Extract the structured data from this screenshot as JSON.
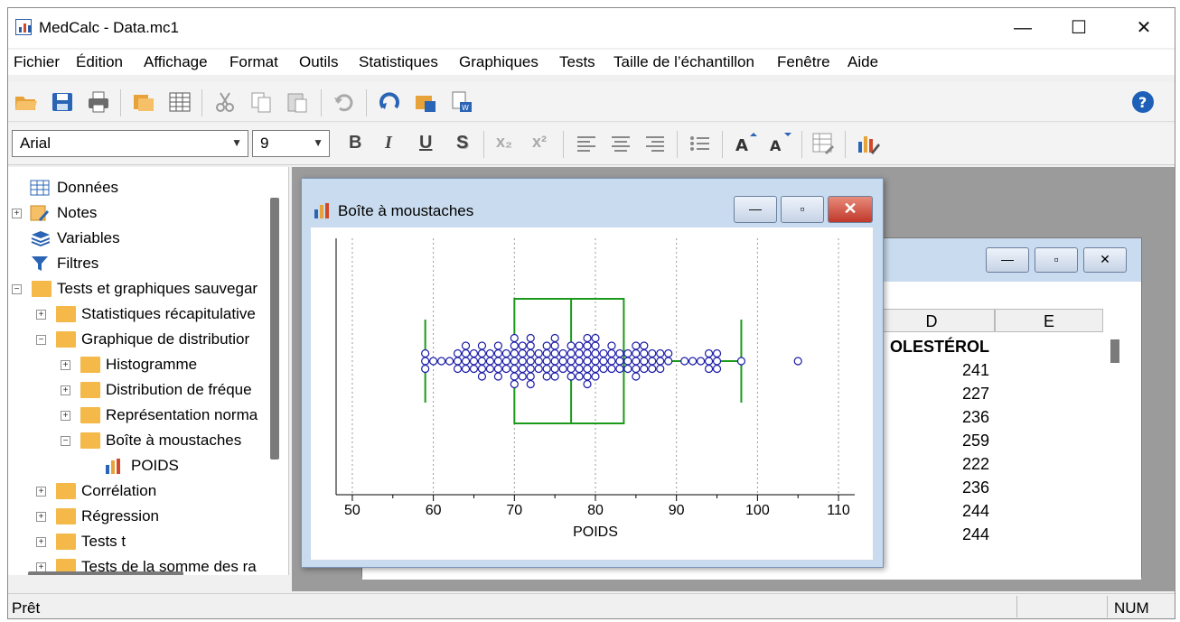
{
  "titlebar": {
    "title": "MedCalc - Data.mc1",
    "min": "—",
    "max": "☐",
    "close": "✕"
  },
  "menu": [
    "Fichier",
    "Édition",
    "Affichage",
    "Format",
    "Outils",
    "Statistiques",
    "Graphiques",
    "Tests",
    "Taille de l’échantillon",
    "Fenêtre",
    "Aide"
  ],
  "format": {
    "font": "Arial",
    "size": "9",
    "bold": "B",
    "italic": "I",
    "underline": "U",
    "shadow": "S",
    "sub": "x₂",
    "sup": "x²"
  },
  "tree": [
    {
      "label": "Données",
      "icon": "table-icon"
    },
    {
      "label": "Notes",
      "icon": "notes-icon"
    },
    {
      "label": "Variables",
      "icon": "variables-icon"
    },
    {
      "label": "Filtres",
      "icon": "filter-icon"
    },
    {
      "label": "Tests et graphiques sauvegar",
      "icon": "folder-icon"
    },
    {
      "label": "Statistiques récapitulative",
      "icon": "folder-icon"
    },
    {
      "label": "Graphique de distributior",
      "icon": "folder-icon"
    },
    {
      "label": "Histogramme",
      "icon": "folder-icon"
    },
    {
      "label": "Distribution de fréque",
      "icon": "folder-icon"
    },
    {
      "label": "Représentation norma",
      "icon": "folder-icon"
    },
    {
      "label": "Boîte à moustaches",
      "icon": "folder-icon"
    },
    {
      "label": "POIDS",
      "icon": "chart-icon"
    },
    {
      "label": "Corrélation",
      "icon": "folder-icon"
    },
    {
      "label": "Régression",
      "icon": "folder-icon"
    },
    {
      "label": "Tests t",
      "icon": "folder-icon"
    },
    {
      "label": "Tests de la somme des ra",
      "icon": "folder-icon"
    }
  ],
  "sheet": {
    "columns": [
      "D",
      "E"
    ],
    "header_cell": "OLESTÉROL",
    "values": [
      "241",
      "227",
      "236",
      "259",
      "222",
      "236",
      "244",
      "244"
    ]
  },
  "boxplot_window": {
    "title": "Boîte à moustaches"
  },
  "chart_data": {
    "type": "box",
    "xlabel": "POIDS",
    "xlim": [
      48,
      112
    ],
    "ticks": [
      "50",
      "60",
      "70",
      "80",
      "90",
      "100",
      "110"
    ],
    "whisker_low": 59,
    "q1": 70,
    "median": 77,
    "q3": 83.5,
    "whisker_high": 98,
    "outliers": [
      105
    ],
    "points": [
      [
        59,
        0
      ],
      [
        59,
        1
      ],
      [
        59,
        -1
      ],
      [
        60,
        0
      ],
      [
        61,
        0
      ],
      [
        62,
        0
      ],
      [
        63,
        0
      ],
      [
        63,
        1
      ],
      [
        63,
        -1
      ],
      [
        64,
        0
      ],
      [
        64,
        1
      ],
      [
        64,
        -1
      ],
      [
        64,
        2
      ],
      [
        65,
        0
      ],
      [
        65,
        1
      ],
      [
        65,
        -1
      ],
      [
        66,
        0
      ],
      [
        66,
        1
      ],
      [
        66,
        -1
      ],
      [
        66,
        2
      ],
      [
        66,
        -2
      ],
      [
        67,
        0
      ],
      [
        67,
        1
      ],
      [
        67,
        -1
      ],
      [
        68,
        0
      ],
      [
        68,
        1
      ],
      [
        68,
        -1
      ],
      [
        68,
        2
      ],
      [
        68,
        -2
      ],
      [
        69,
        0
      ],
      [
        69,
        1
      ],
      [
        69,
        -1
      ],
      [
        70,
        0
      ],
      [
        70,
        1
      ],
      [
        70,
        -1
      ],
      [
        70,
        2
      ],
      [
        70,
        -2
      ],
      [
        70,
        3
      ],
      [
        70,
        -3
      ],
      [
        71,
        0
      ],
      [
        71,
        1
      ],
      [
        71,
        -1
      ],
      [
        71,
        2
      ],
      [
        71,
        -2
      ],
      [
        72,
        0
      ],
      [
        72,
        1
      ],
      [
        72,
        -1
      ],
      [
        72,
        2
      ],
      [
        72,
        -2
      ],
      [
        72,
        3
      ],
      [
        72,
        -3
      ],
      [
        73,
        0
      ],
      [
        73,
        1
      ],
      [
        73,
        -1
      ],
      [
        74,
        0
      ],
      [
        74,
        1
      ],
      [
        74,
        -1
      ],
      [
        74,
        2
      ],
      [
        74,
        -2
      ],
      [
        75,
        0
      ],
      [
        75,
        1
      ],
      [
        75,
        -1
      ],
      [
        75,
        2
      ],
      [
        75,
        -2
      ],
      [
        75,
        3
      ],
      [
        76,
        0
      ],
      [
        76,
        1
      ],
      [
        76,
        -1
      ],
      [
        77,
        0
      ],
      [
        77,
        1
      ],
      [
        77,
        -1
      ],
      [
        77,
        2
      ],
      [
        77,
        -2
      ],
      [
        78,
        0
      ],
      [
        78,
        1
      ],
      [
        78,
        -1
      ],
      [
        78,
        2
      ],
      [
        78,
        -2
      ],
      [
        79,
        0
      ],
      [
        79,
        1
      ],
      [
        79,
        -1
      ],
      [
        79,
        2
      ],
      [
        79,
        -2
      ],
      [
        79,
        3
      ],
      [
        79,
        -3
      ],
      [
        80,
        0
      ],
      [
        80,
        1
      ],
      [
        80,
        -1
      ],
      [
        80,
        2
      ],
      [
        80,
        -2
      ],
      [
        80,
        3
      ],
      [
        81,
        0
      ],
      [
        81,
        1
      ],
      [
        81,
        -1
      ],
      [
        82,
        0
      ],
      [
        82,
        1
      ],
      [
        82,
        -1
      ],
      [
        82,
        2
      ],
      [
        83,
        0
      ],
      [
        83,
        1
      ],
      [
        83,
        -1
      ],
      [
        84,
        0
      ],
      [
        84,
        1
      ],
      [
        84,
        -1
      ],
      [
        85,
        0
      ],
      [
        85,
        1
      ],
      [
        85,
        -1
      ],
      [
        85,
        2
      ],
      [
        85,
        -2
      ],
      [
        86,
        0
      ],
      [
        86,
        1
      ],
      [
        86,
        -1
      ],
      [
        86,
        2
      ],
      [
        87,
        0
      ],
      [
        87,
        1
      ],
      [
        87,
        -1
      ],
      [
        88,
        0
      ],
      [
        88,
        1
      ],
      [
        88,
        -1
      ],
      [
        89,
        0
      ],
      [
        89,
        1
      ],
      [
        91,
        0
      ],
      [
        92,
        0
      ],
      [
        93,
        0
      ],
      [
        94,
        0
      ],
      [
        94,
        1
      ],
      [
        94,
        -1
      ],
      [
        95,
        0
      ],
      [
        95,
        1
      ],
      [
        95,
        -1
      ],
      [
        98,
        0
      ],
      [
        105,
        0
      ]
    ],
    "box_color": "#1a9a1a",
    "point_color": "#1a1aa8"
  },
  "status": {
    "left": "Prêt",
    "right": "NUM"
  },
  "colors": {
    "accent": "#2a64b4",
    "folder": "#f5b94a",
    "help": "#1e5fb8"
  }
}
